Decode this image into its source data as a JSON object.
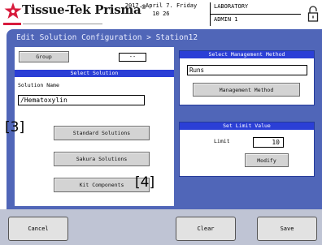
{
  "header": {
    "brand": "Tissue-Tek Prisma",
    "brand_mark": "®",
    "datetime": "2017. April 7. Friday\n10 26",
    "department": "LABORATORY",
    "user": "ADMIN 1",
    "logo_color": "#d81b3c"
  },
  "main": {
    "title": "Edit Solution Configuration > Station12",
    "group": {
      "button_label": "Group",
      "value": "--"
    },
    "select_solution": {
      "heading": "Select Solution",
      "name_label": "Solution Name",
      "name_value": "/Hematoxylin",
      "buttons": {
        "standard": "Standard Solutions",
        "sakura": "Sakura Solutions",
        "kit": "Kit Components"
      }
    },
    "management": {
      "heading": "Select Management Method",
      "value": "Runs",
      "button_label": "Management Method"
    },
    "limit": {
      "heading": "Set Limit Value",
      "label": "Limit",
      "value": "10",
      "button_label": "Modify"
    },
    "markers": {
      "m3": "[3]",
      "m4": "[4]"
    },
    "frame_color": "#5066b8",
    "heading_color": "#2b3fd6"
  },
  "footer": {
    "cancel_label": "Cancel",
    "clear_label": "Clear",
    "save_label": "Save"
  }
}
